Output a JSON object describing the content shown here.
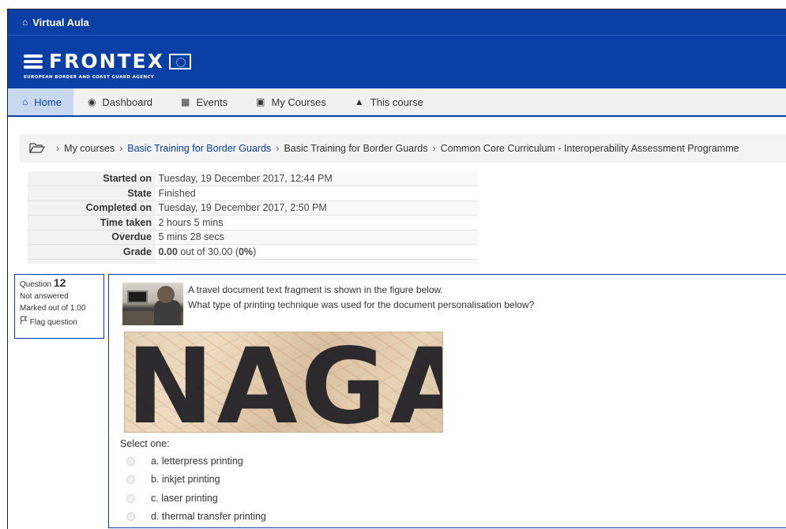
{
  "header": {
    "site_name": "Virtual Aula",
    "brand": "FRONTEX",
    "tagline": "EUROPEAN BORDER AND COAST GUARD AGENCY"
  },
  "nav": {
    "items": [
      {
        "label": "Home",
        "icon": "home-icon"
      },
      {
        "label": "Dashboard",
        "icon": "dashboard-icon"
      },
      {
        "label": "Events",
        "icon": "calendar-icon"
      },
      {
        "label": "My Courses",
        "icon": "briefcase-icon"
      },
      {
        "label": "This course",
        "icon": "sitemap-icon"
      }
    ]
  },
  "breadcrumb": {
    "items": [
      "My courses",
      "Basic Training for Border Guards",
      "Basic Training for Border Guards",
      "Common Core Curriculum - Interoperability Assessment Programme"
    ]
  },
  "summary": {
    "rows": [
      {
        "label": "Started on",
        "value": "Tuesday, 19 December 2017, 12:44 PM"
      },
      {
        "label": "State",
        "value": "Finished"
      },
      {
        "label": "Completed on",
        "value": "Tuesday, 19 December 2017, 2:50 PM"
      },
      {
        "label": "Time taken",
        "value": "2 hours 5 mins"
      },
      {
        "label": "Overdue",
        "value": "5 mins 28 secs"
      }
    ],
    "grade": {
      "label": "Grade",
      "score": "0.00",
      "out_of": "out of 30.00 (",
      "percent": "0%",
      "close": ")"
    }
  },
  "question": {
    "prefix": "Question",
    "number": "12",
    "status": "Not answered",
    "marks": "Marked out of 1.00",
    "flag_label": "Flag question",
    "text_line1": "A travel document text fragment is shown in the figure below.",
    "text_line2": "What type of printing technique was used for the document personalisation below?",
    "figure_text": "NAGA",
    "select_label": "Select one:",
    "options": [
      "a. letterpress printing",
      "b. inkjet printing",
      "c. laser printing",
      "d. thermal transfer printing"
    ]
  },
  "colors": {
    "brand_blue": "#0a3fa6",
    "nav_active_bg": "#c7d9ef",
    "link": "#0a3fa6"
  }
}
